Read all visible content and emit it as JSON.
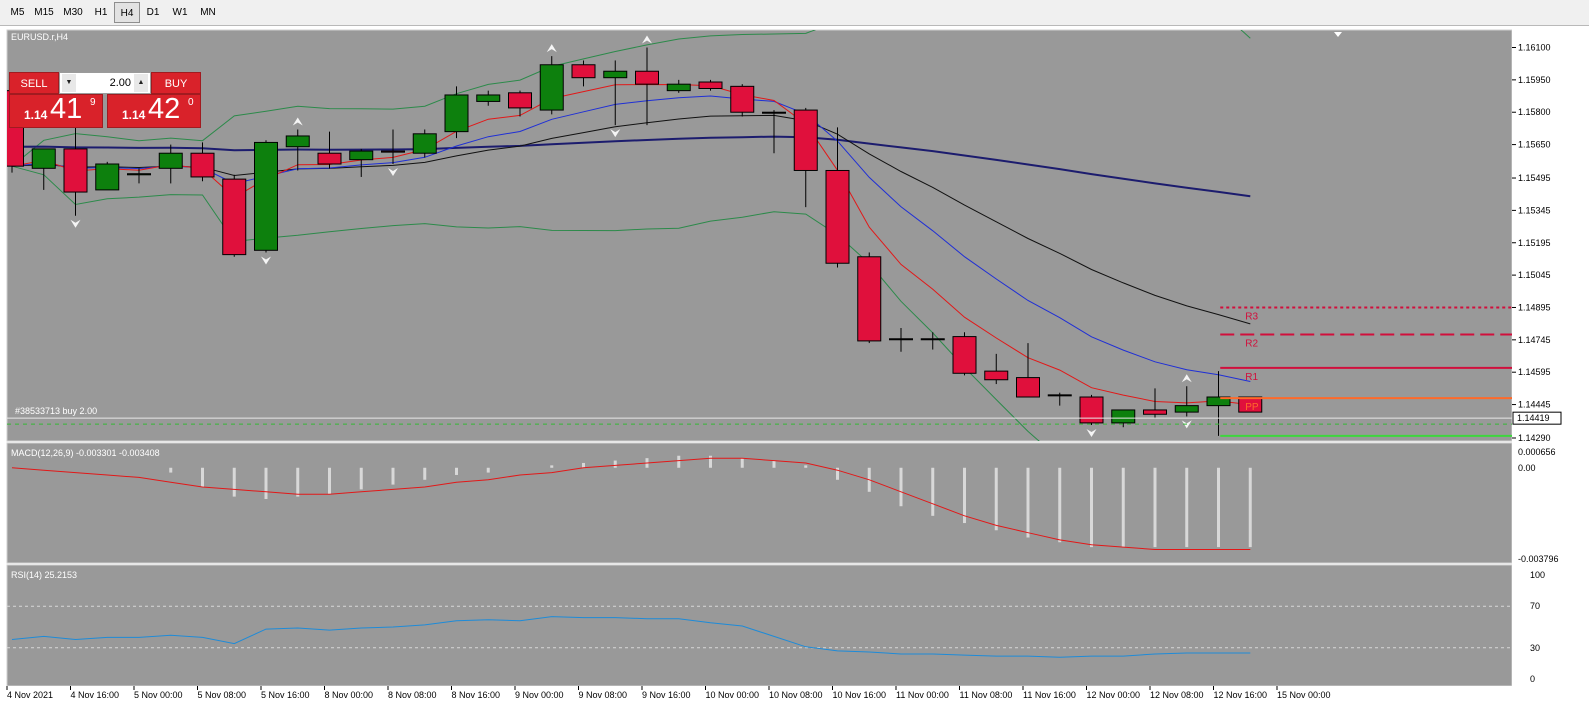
{
  "timeframes": [
    "M5",
    "M15",
    "M30",
    "H1",
    "H4",
    "D1",
    "W1",
    "MN"
  ],
  "active_timeframe": "H4",
  "chart": {
    "symbol_title": "EURUSD.r,H4",
    "order_label": "#38533713 buy 2.00",
    "current_price": "1.14419",
    "pivot_labels": [
      "R3",
      "R2",
      "R1",
      "PP"
    ],
    "price_axis": [
      "1.16100",
      "1.15950",
      "1.15800",
      "1.15650",
      "1.15495",
      "1.15345",
      "1.15195",
      "1.15045",
      "1.14895",
      "1.14745",
      "1.14595",
      "1.14445",
      "1.14290"
    ],
    "time_axis": [
      "4 Nov 2021",
      "4 Nov 16:00",
      "5 Nov 00:00",
      "5 Nov 08:00",
      "5 Nov 16:00",
      "8 Nov 00:00",
      "8 Nov 08:00",
      "8 Nov 16:00",
      "9 Nov 00:00",
      "9 Nov 08:00",
      "9 Nov 16:00",
      "10 Nov 00:00",
      "10 Nov 08:00",
      "10 Nov 16:00",
      "11 Nov 00:00",
      "11 Nov 08:00",
      "11 Nov 16:00",
      "12 Nov 00:00",
      "12 Nov 08:00",
      "12 Nov 16:00",
      "15 Nov 00:00"
    ]
  },
  "trade_panel": {
    "sell_label": "SELL",
    "buy_label": "BUY",
    "lot": "2.00",
    "sell_prefix": "1.14",
    "sell_big": "41",
    "sell_sup": "9",
    "buy_prefix": "1.14",
    "buy_big": "42",
    "buy_sup": "0"
  },
  "macd": {
    "label": "MACD(12,26,9) -0.003301 -0.003408",
    "axis": [
      "0.000656",
      "0.00",
      "-0.003796"
    ],
    "values": [
      0.0,
      0.0,
      0.0,
      0.0,
      0.0,
      -0.0002,
      -0.0008,
      -0.0012,
      -0.0013,
      -0.0012,
      -0.0011,
      -0.0009,
      -0.0007,
      -0.0005,
      -0.0003,
      -0.0002,
      0.0,
      0.0001,
      0.0002,
      0.0003,
      0.0004,
      0.0005,
      0.0005,
      0.0004,
      0.0003,
      0.0001,
      -0.0005,
      -0.001,
      -0.0016,
      -0.002,
      -0.0023,
      -0.0026,
      -0.0029,
      -0.0031,
      -0.0033,
      -0.0033,
      -0.0033,
      -0.0033,
      -0.0033,
      -0.0033
    ],
    "signal": [
      0.0,
      -0.0001,
      -0.0002,
      -0.0003,
      -0.0004,
      -0.0006,
      -0.0008,
      -0.0009,
      -0.001,
      -0.0011,
      -0.0011,
      -0.001,
      -0.0009,
      -0.0008,
      -0.0006,
      -0.0005,
      -0.0003,
      -0.0002,
      0.0,
      0.0001,
      0.0002,
      0.0003,
      0.0004,
      0.0004,
      0.0003,
      0.0002,
      -0.0001,
      -0.0005,
      -0.001,
      -0.0015,
      -0.002,
      -0.0024,
      -0.0027,
      -0.003,
      -0.0032,
      -0.0033,
      -0.0034,
      -0.0034,
      -0.0034,
      -0.0034
    ]
  },
  "rsi": {
    "label": "RSI(14) 25.2153",
    "axis": [
      "100",
      "70",
      "30",
      "0"
    ],
    "values": [
      38,
      41,
      38,
      40,
      40,
      42,
      40,
      34,
      48,
      49,
      47,
      49,
      50,
      52,
      56,
      57,
      56,
      60,
      59,
      59,
      58,
      58,
      54,
      51,
      41,
      31,
      27,
      26,
      24,
      24,
      23,
      22,
      22,
      21,
      22,
      22,
      24,
      25,
      25,
      25
    ]
  },
  "colors": {
    "chart_bg": "#999999",
    "bull": "#0d800d",
    "bear": "#e0103c",
    "ma_slow": "#1c1c6e",
    "ma_mid": "#111111",
    "ma_fast": "#1f2fd6",
    "ma_red": "#e21818",
    "bands": "#2c8a4a",
    "rsi": "#1e8bd8",
    "pivot_r": "#d10f3c",
    "pivot_s": "#3ed63e",
    "pp": "#ff6a2a"
  },
  "candles": [
    [
      1.159,
      1.1596,
      1.1552,
      1.1555
    ],
    [
      1.1554,
      1.1563,
      1.1544,
      1.1563
    ],
    [
      1.1563,
      1.1573,
      1.1532,
      1.1543
    ],
    [
      1.1544,
      1.1557,
      1.1544,
      1.1556
    ],
    [
      1.1551,
      1.1554,
      1.1547,
      1.15515
    ],
    [
      1.1554,
      1.1565,
      1.1547,
      1.1561
    ],
    [
      1.1561,
      1.1566,
      1.1548,
      1.155
    ],
    [
      1.1549,
      1.1551,
      1.1513,
      1.1514
    ],
    [
      1.1516,
      1.1567,
      1.1515,
      1.1566
    ],
    [
      1.1564,
      1.1572,
      1.1553,
      1.1569
    ],
    [
      1.1561,
      1.1571,
      1.1554,
      1.1556
    ],
    [
      1.1558,
      1.1563,
      1.155,
      1.1562
    ],
    [
      1.1562,
      1.1572,
      1.1556,
      1.15615
    ],
    [
      1.1561,
      1.1572,
      1.1559,
      1.157
    ],
    [
      1.1571,
      1.1592,
      1.1568,
      1.1588
    ],
    [
      1.1585,
      1.159,
      1.1583,
      1.1588
    ],
    [
      1.1589,
      1.159,
      1.1578,
      1.1582
    ],
    [
      1.1581,
      1.1606,
      1.1579,
      1.1602
    ],
    [
      1.1602,
      1.1604,
      1.1592,
      1.1596
    ],
    [
      1.1596,
      1.1604,
      1.1574,
      1.1599
    ],
    [
      1.1599,
      1.161,
      1.1574,
      1.1593
    ],
    [
      1.159,
      1.1595,
      1.1589,
      1.1593
    ],
    [
      1.1594,
      1.1595,
      1.159,
      1.1591
    ],
    [
      1.1592,
      1.1593,
      1.1578,
      1.158
    ],
    [
      1.158,
      1.1581,
      1.1561,
      1.158
    ],
    [
      1.1581,
      1.1582,
      1.1536,
      1.1553
    ],
    [
      1.1553,
      1.1573,
      1.1508,
      1.151
    ],
    [
      1.1513,
      1.1515,
      1.1473,
      1.1474
    ],
    [
      1.1475,
      1.148,
      1.1469,
      1.1475
    ],
    [
      1.1475,
      1.1478,
      1.147,
      1.1475
    ],
    [
      1.1476,
      1.1478,
      1.1458,
      1.1459
    ],
    [
      1.146,
      1.1468,
      1.1454,
      1.1456
    ],
    [
      1.1457,
      1.1473,
      1.1448,
      1.1448
    ],
    [
      1.1449,
      1.145,
      1.1444,
      1.1449
    ],
    [
      1.1448,
      1.1449,
      1.1435,
      1.1436
    ],
    [
      1.1436,
      1.1442,
      1.1434,
      1.1442
    ],
    [
      1.1442,
      1.1452,
      1.1438,
      1.144
    ],
    [
      1.1441,
      1.1453,
      1.1439,
      1.1444
    ],
    [
      1.1444,
      1.146,
      1.143,
      1.1448
    ],
    [
      1.1448,
      1.1448,
      1.1441,
      1.1441
    ]
  ]
}
